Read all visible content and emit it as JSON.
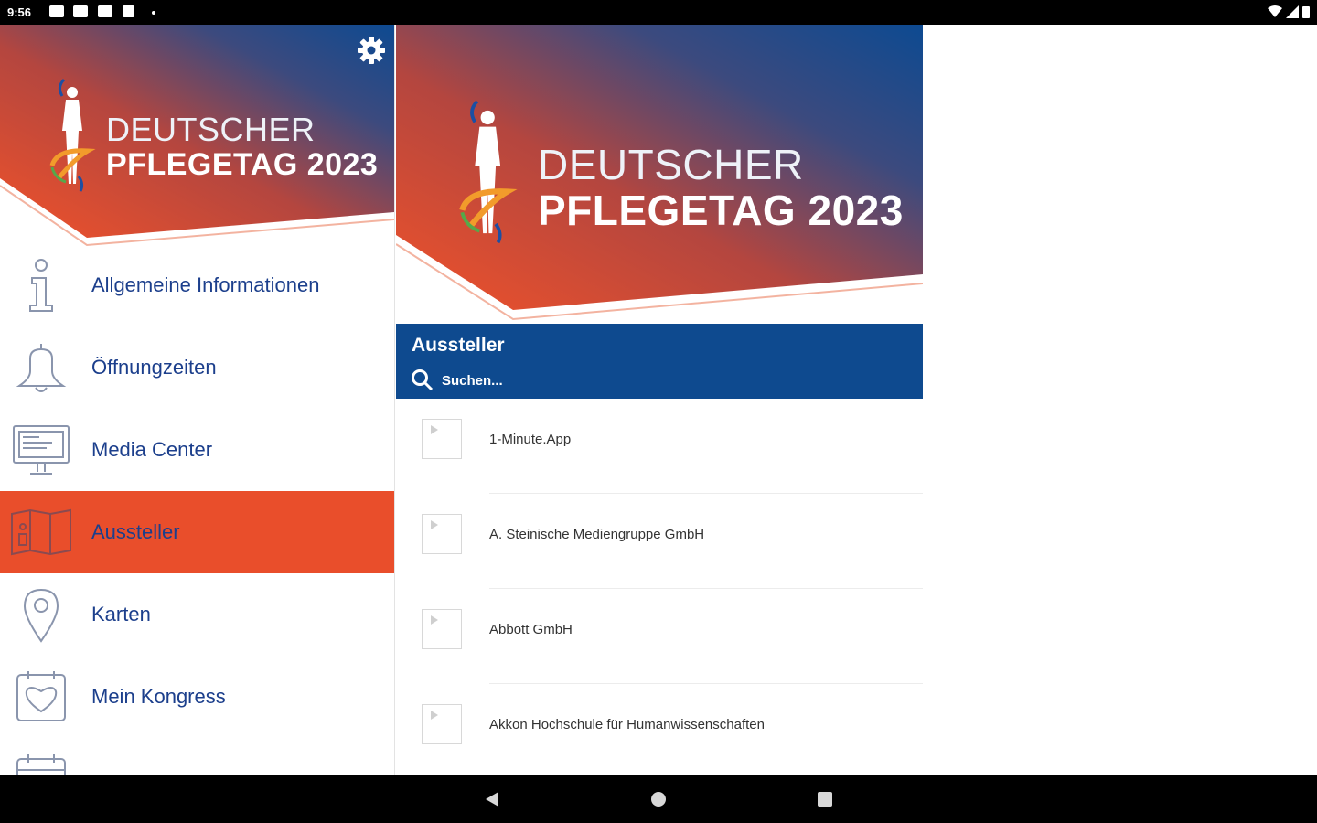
{
  "status_bar": {
    "time": "9:56"
  },
  "brand": {
    "line1": "DEUTSCHER",
    "line2": "PFLEGETAG 2023"
  },
  "menu": {
    "items": [
      {
        "label": "Allgemeine Informationen",
        "icon": "info-icon"
      },
      {
        "label": "Öffnungzeiten",
        "icon": "bell-icon"
      },
      {
        "label": "Media Center",
        "icon": "monitor-icon"
      },
      {
        "label": "Aussteller",
        "icon": "map-book-icon",
        "active": true
      },
      {
        "label": "Karten",
        "icon": "location-pin-icon"
      },
      {
        "label": "Mein Kongress",
        "icon": "heart-calendar-icon"
      }
    ]
  },
  "panel": {
    "title": "Aussteller",
    "search_placeholder": "Suchen..."
  },
  "exhibitors": [
    "1-Minute.App",
    "A. Steinische Mediengruppe GmbH",
    "Abbott GmbH",
    "Akkon Hochschule für Humanwissenschaften"
  ],
  "colors": {
    "accent_orange": "#e94e2b",
    "brand_blue": "#0e4a8f",
    "menu_text": "#1c3f8c"
  }
}
